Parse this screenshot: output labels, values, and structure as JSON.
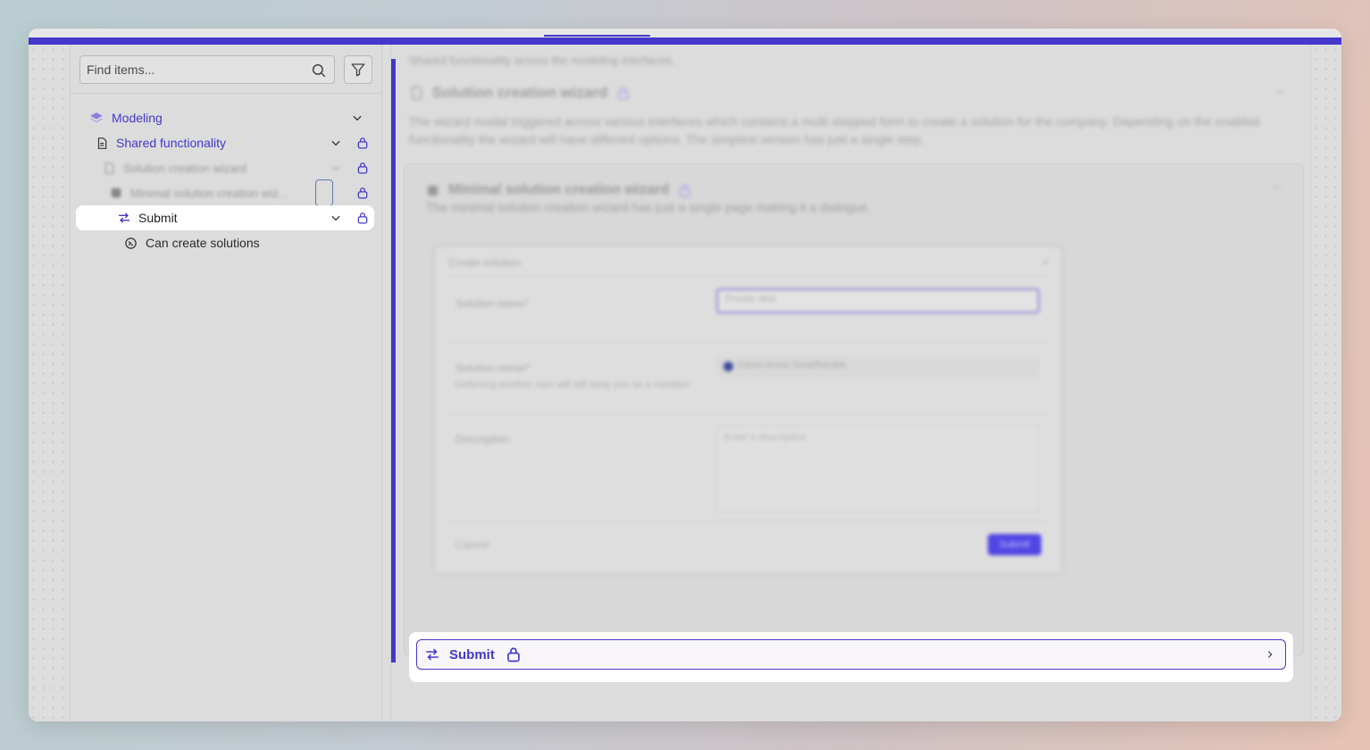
{
  "colors": {
    "accent": "#4338ca",
    "highlight_bg": "#ffffff",
    "window_bg": "#dddddd"
  },
  "sidebar": {
    "search": {
      "placeholder": "Find items..."
    },
    "tree": [
      {
        "id": "modeling",
        "label": "Modeling",
        "icon": "layers-icon",
        "expanded": true
      },
      {
        "id": "shared",
        "label": "Shared functionality",
        "icon": "document-icon",
        "expanded": true,
        "locked": true
      },
      {
        "id": "solution-wizard",
        "label": "Solution creation wizard",
        "icon": "document-icon",
        "locked": true
      },
      {
        "id": "minimal-wizard",
        "label": "Minimal solution creation wiz...",
        "icon": "component-icon",
        "locked": true
      },
      {
        "id": "submit",
        "label": "Submit",
        "icon": "action-arrow-icon",
        "expanded": true,
        "locked": true,
        "selected": true
      },
      {
        "id": "can-create",
        "label": "Can create solutions",
        "icon": "permission-icon"
      }
    ]
  },
  "main": {
    "top_description": "Shared functionality across the modeling interfaces.",
    "section": {
      "title": "Solution creation wizard",
      "description": "The wizard modal triggered across various interfaces which contains a multi stepped form to create a solution for the company. Depending on the enabled functionality the wizard will have different options. The simplest version has just a single step."
    },
    "card": {
      "title": "Minimal solution creation wizard",
      "description": "The minimal solution creation wizard has just a single page making it a dialogue.",
      "dialog": {
        "title": "Create solution",
        "close": "×",
        "fields": {
          "name_label": "Solution name*",
          "name_placeholder": "Private dish",
          "owner_label": "Solution owner*",
          "owner_help": "Deferring another user will still keep you as a member",
          "owner_value": "Karen Anna Smartheckle",
          "description_label": "Description",
          "description_placeholder": "Enter a description"
        },
        "cancel": "Cancel",
        "submit": "Submit"
      }
    },
    "submit_bar": {
      "label": "Submit"
    }
  }
}
